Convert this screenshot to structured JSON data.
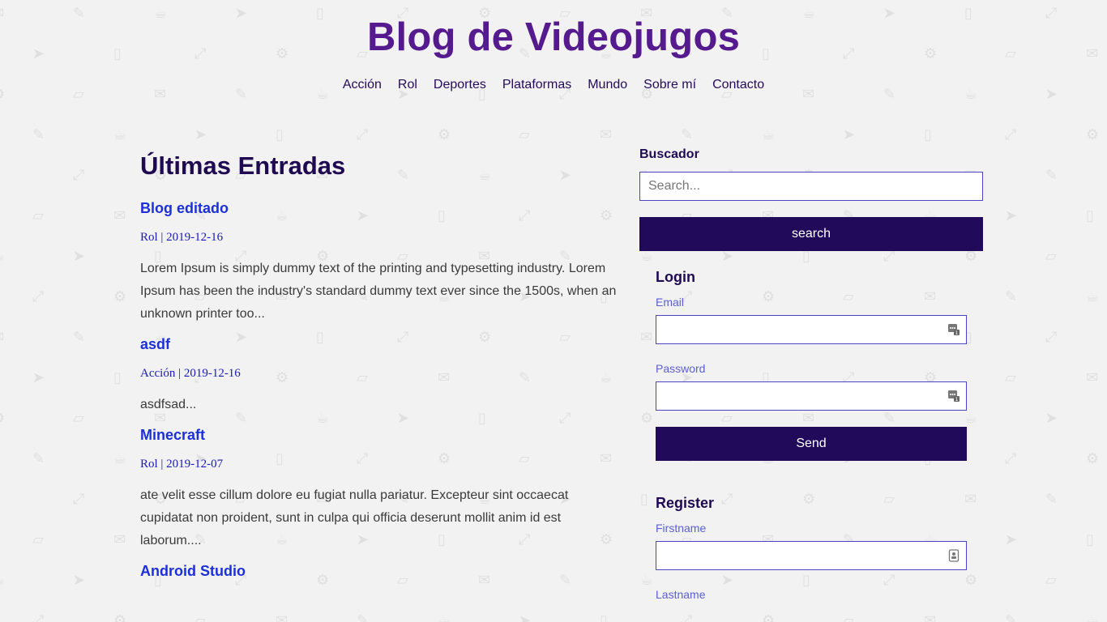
{
  "header": {
    "title": "Blog de Videojugos",
    "nav": [
      "Acción",
      "Rol",
      "Deportes",
      "Plataformas",
      "Mundo",
      "Sobre mí",
      "Contacto"
    ]
  },
  "main": {
    "section_title": "Últimas Entradas",
    "posts": [
      {
        "title": "Blog editado",
        "meta": "Rol | 2019-12-16",
        "excerpt": "Lorem Ipsum is simply dummy text of the printing and typesetting industry. Lorem Ipsum has been the industry's standard dummy text ever since the 1500s, when an unknown printer too..."
      },
      {
        "title": "asdf",
        "meta": "Acción | 2019-12-16",
        "excerpt": "asdfsad..."
      },
      {
        "title": "Minecraft",
        "meta": "Rol | 2019-12-07",
        "excerpt": "ate velit esse cillum dolore eu fugiat nulla pariatur. Excepteur sint occaecat cupidatat non proident, sunt in culpa qui officia deserunt mollit anim id est laborum...."
      },
      {
        "title": "Android Studio"
      }
    ]
  },
  "sidebar": {
    "search": {
      "label": "Buscador",
      "placeholder": "Search...",
      "button": "search"
    },
    "login": {
      "title": "Login",
      "email_label": "Email",
      "password_label": "Password",
      "button": "Send"
    },
    "register": {
      "title": "Register",
      "firstname_label": "Firstname",
      "lastname_label": "Lastname"
    }
  },
  "colors": {
    "title": "#561a8f",
    "nav": "#240b59",
    "link": "#1c2fdc",
    "button_bg": "#220a5a",
    "input_border": "#4b44c9",
    "field_label": "#5b5fd6",
    "background": "#f2f2f2"
  },
  "icons": {
    "field_autofill": "password-manager-icon",
    "field_contact": "contact-card-icon"
  }
}
